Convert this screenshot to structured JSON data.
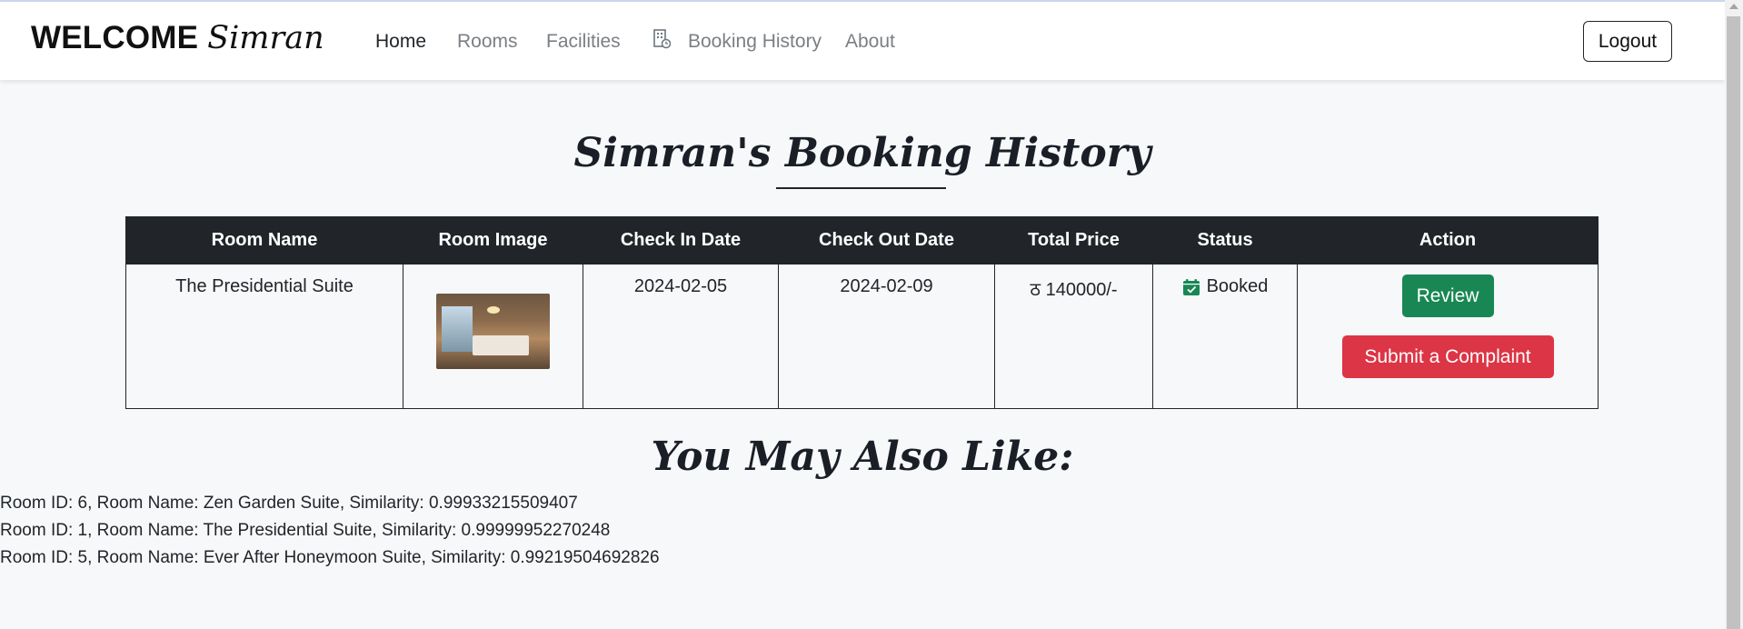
{
  "navbar": {
    "welcome": "WELCOME",
    "user": "Simran",
    "links": [
      "Home",
      "Rooms",
      "Facilities",
      "Booking History",
      "About"
    ],
    "active": "Home",
    "logout_label": "Logout"
  },
  "page": {
    "title": "Simran's Booking History",
    "recommend_title": "You May Also Like:"
  },
  "table": {
    "headers": [
      "Room Name",
      "Room Image",
      "Check In Date",
      "Check Out Date",
      "Total Price",
      "Status",
      "Action"
    ],
    "rows": [
      {
        "room_name": "The Presidential Suite",
        "check_in": "2024-02-05",
        "check_out": "2024-02-09",
        "total_price": "ठ 140000/-",
        "status": "Booked",
        "review_label": "Review",
        "complaint_label": "Submit a Complaint"
      }
    ]
  },
  "recommendations": [
    "Room ID: 6, Room Name: Zen Garden Suite, Similarity: 0.99933215509407",
    "Room ID: 1, Room Name: The Presidential Suite, Similarity: 0.99999952270248",
    "Room ID: 5, Room Name: Ever After Honeymoon Suite, Similarity: 0.99219504692826"
  ],
  "colors": {
    "navbar_bg": "#ffffff",
    "table_header_bg": "#212529",
    "review_button": "#198754",
    "complaint_button": "#dc3545",
    "status_icon": "#198754"
  },
  "icons": [
    "booking-history-icon",
    "calendar-check-icon",
    "room-image"
  ]
}
